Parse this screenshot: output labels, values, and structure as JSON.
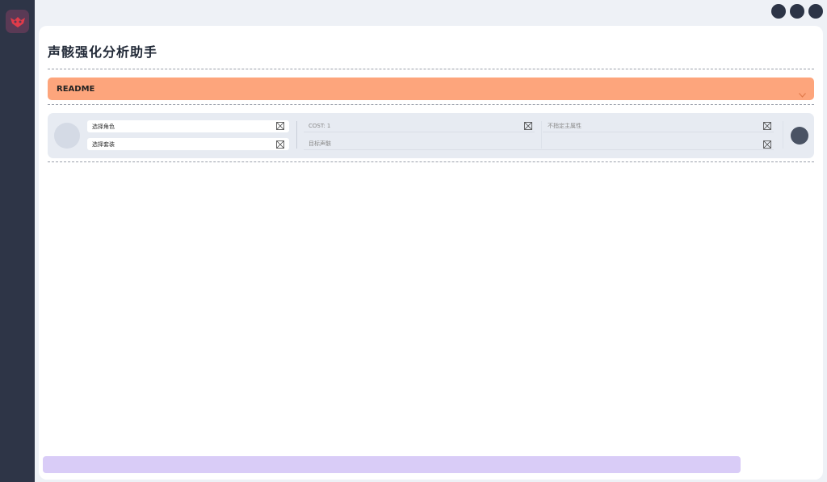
{
  "app": {
    "title": "声骸强化分析助手"
  },
  "readme": {
    "label": "README"
  },
  "panel": {
    "character_placeholder": "选择角色",
    "set_placeholder": "选择套装",
    "cost_placeholder": "COST: 1",
    "main_stat_placeholder": "不指定主属性",
    "target_echo_placeholder": "目标声骸"
  },
  "colors": {
    "sidebar": "#2e3547",
    "readme_bg": "#fda57c",
    "panel_bg": "#e7ebf2",
    "bottom_bar": "#d9ccf7"
  },
  "icons": {
    "logo": "app-logo-icon",
    "clear": "clear-x-icon",
    "chevron": "chevron-down-icon"
  }
}
